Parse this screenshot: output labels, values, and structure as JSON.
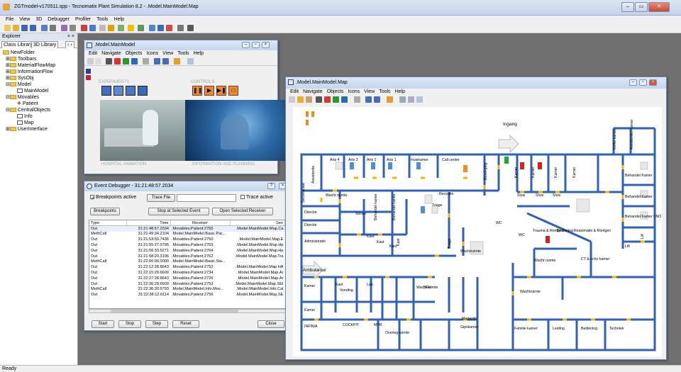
{
  "app": {
    "title": "ZGTmodel-v170511.spp - Tecnomatix Plant Simulation 8.2 - .Model.MainModel.Map",
    "status": "Ready"
  },
  "menu": [
    "File",
    "View",
    "3D",
    "Debugger",
    "Profiler",
    "Tools",
    "Help"
  ],
  "explorer": {
    "title": "Explorer",
    "tabs": [
      "Class Library",
      "3D Library"
    ],
    "tree": [
      "NewFolder",
      "Toolbars",
      "MaterialFlowMap",
      "InformationFlow",
      "SysObj",
      "Model",
      "MainModel",
      "Movables",
      "Patient",
      "CentralObjects",
      "Info",
      "Map",
      "UserInterface"
    ]
  },
  "main_model": {
    "title": ".Model.MainModel",
    "menu": [
      "Edit",
      "Navigate",
      "Objects",
      "Icons",
      "View",
      "Tools",
      "Help"
    ],
    "experiments": "EXPERIMENTS",
    "controls": "CONTROLS",
    "hospital_animation": "HOSPITAL ANIMATION",
    "info_planning": "INFORMATION AND PLANNING"
  },
  "debugger": {
    "title": "Event Debugger - 31:21:48:57.2034",
    "bp_active": "Breakpoints active",
    "trace_file": "Trace File",
    "trace_active": "Trace active",
    "breakpoints": "Breakpoints",
    "stop_selected": "Stop at Selected Event",
    "open_receiver": "Open Selected Receiver",
    "columns": [
      "Type",
      "Time",
      "Receiver",
      "Sen"
    ],
    "rows": [
      [
        "Out",
        "31:21:48:57.2034",
        ".Movables.Patient:2765",
        ".Model.MainModel.Map.Ca"
      ],
      [
        "MethCall",
        "31:21:49:34.2104",
        ".Model.MainModel.Basic.Pat...",
        ""
      ],
      [
        "Out",
        "31:21:53:50.7436",
        ".Movables.Patient:2750",
        ".Model.MainModel.Map.E"
      ],
      [
        "Out",
        "31:21:55:27.0795",
        ".Movables.Patient:2763",
        ".Model.MainModel.Map.Hp"
      ],
      [
        "Out",
        "31:21:56:33.5271",
        ".Movables.Patient:2764",
        ".Model.MainModel.Map.Hp"
      ],
      [
        "Out",
        "31:21:58:20.3196",
        ".Movables.Patient:2762",
        ".Model.MainModel.Map.Tra"
      ],
      [
        "MethCall",
        "31:22:00:00.0000",
        ".Model.MainModel.Basic.Sta...",
        ""
      ],
      [
        "Out",
        "31:22:12:28.8643",
        ".Movables.Patient:2752",
        ".Model.MainModel.Map.HA"
      ],
      [
        "Out",
        "31:22:15:29.6609",
        ".Movables.Patient:2734",
        ".Model.MainModel.Map.Ar"
      ],
      [
        "Out",
        "31:22:27:28.8643",
        ".Movables.Patient:2726",
        ".Model.MainModel.Map.Ar"
      ],
      [
        "Out",
        "31:22:30:29.6609",
        ".Movables.Patient:2753",
        ".Model.MainModel.Map.SEI"
      ],
      [
        "MethCall",
        "31:22:36:20.9793",
        ".Model.MainModel.Info.Mov...",
        ".Model.MainModel.Info.Cal"
      ],
      [
        "Out",
        "31:22:38:12.6114",
        ".Movables.Patient:2756",
        ".Model.MainModel.Map.SE"
      ]
    ],
    "buttons": [
      "Start",
      "Stop",
      "Step",
      "Reset",
      "Close"
    ]
  },
  "map": {
    "title": ".Model.MainModel.Map",
    "menu": [
      "Edit",
      "Navigate",
      "Objects",
      "Icons",
      "View",
      "Tools",
      "Help"
    ],
    "labels": [
      {
        "t": "Ingang"
      },
      {
        "t": "Arts 4"
      },
      {
        "t": "Arts 3"
      },
      {
        "t": "Arts 2"
      },
      {
        "t": "Arts 1"
      },
      {
        "t": "Huiskamer"
      },
      {
        "t": "Call center"
      },
      {
        "t": "Secretariaat"
      },
      {
        "t": "Assistentie"
      },
      {
        "t": "Receptie"
      },
      {
        "t": "Bevel-ging"
      },
      {
        "t": "Wacht ruimte"
      },
      {
        "t": "Directie"
      },
      {
        "t": "Directie"
      },
      {
        "t": "Server"
      },
      {
        "t": "Behandel kamer"
      },
      {
        "t": "Behandel kamer"
      },
      {
        "t": "Triage"
      },
      {
        "t": "WC"
      },
      {
        "t": "Administratie"
      },
      {
        "t": "Kast"
      },
      {
        "t": "Kast"
      },
      {
        "t": "Kast"
      },
      {
        "t": "Kast"
      },
      {
        "t": "Triage"
      },
      {
        "t": "Wachtruimte"
      },
      {
        "t": "Ambulance"
      },
      {
        "t": "Kamer"
      },
      {
        "t": "Kamer"
      },
      {
        "t": "Lab"
      },
      {
        "t": "Kast"
      },
      {
        "t": "Voeding"
      },
      {
        "t": "Wacht ruimte"
      },
      {
        "t": "SEH"
      },
      {
        "t": "INFINIA"
      },
      {
        "t": "COCKPIT"
      },
      {
        "t": "MPR"
      },
      {
        "t": "Magazijn"
      },
      {
        "t": "Gipskamer"
      },
      {
        "t": "Overleg ruimte"
      },
      {
        "t": "Kamer"
      },
      {
        "t": "Kamer"
      },
      {
        "t": "Sluis"
      },
      {
        "t": "Sluis"
      },
      {
        "t": "Sluis"
      },
      {
        "t": "Kamer"
      },
      {
        "t": "Kamer"
      },
      {
        "t": "Behandel Kamer"
      },
      {
        "t": "Behandel Kamer"
      },
      {
        "t": "Behandel Kamer KNO"
      },
      {
        "t": "Trauma & Röntgen"
      },
      {
        "t": "Bediening"
      },
      {
        "t": "Reanimatie & Röntgen"
      },
      {
        "t": "WC"
      },
      {
        "t": "Lift"
      },
      {
        "t": "Lift"
      },
      {
        "t": "Koffie kamer"
      },
      {
        "t": "Assistenten kamer"
      },
      {
        "t": "Wacht ruimte"
      },
      {
        "t": "CT & echo kamer"
      },
      {
        "t": "Wachtruimte"
      },
      {
        "t": "Familie kamer"
      },
      {
        "t": "Leiding"
      },
      {
        "t": "Bediening"
      },
      {
        "t": "Techniek"
      }
    ]
  },
  "colors": {
    "wall": "#2e62b5",
    "door": "#f4b400",
    "accent": "#e8e8e8"
  }
}
